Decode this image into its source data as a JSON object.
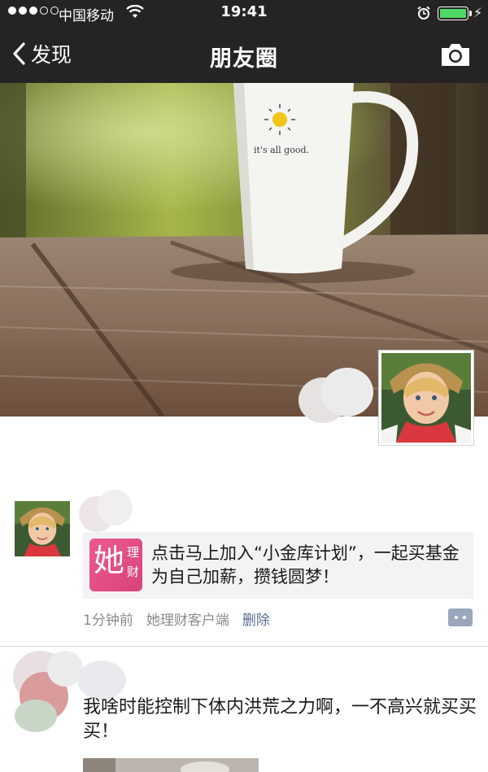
{
  "status_bar": {
    "carrier": "中国移动",
    "time": "19:41",
    "battery_level": 1.0
  },
  "nav": {
    "back_label": "发现",
    "title": "朋友圈",
    "back_icon": "chevron-left-icon",
    "camera_icon": "camera-icon"
  },
  "cover": {
    "mug_text": "it's all good."
  },
  "posts": [
    {
      "link": {
        "logo_big": "她",
        "logo_small_1": "理",
        "logo_small_2": "财",
        "text": "点击马上加入“小金库计划”，一起买基金为自己加薪，攒钱圆梦！"
      },
      "time": "1分钟前",
      "source": "她理财客户端",
      "delete_label": "删除"
    },
    {
      "text": "我啥时能控制下体内洪荒之力啊，一不高兴就买买买！"
    }
  ],
  "colors": {
    "nav_bg": "#262423",
    "link_color": "#586c94",
    "meta_gray": "#8a8a8a",
    "battery_green": "#4cd964",
    "logo_pink": "#e34e86"
  }
}
